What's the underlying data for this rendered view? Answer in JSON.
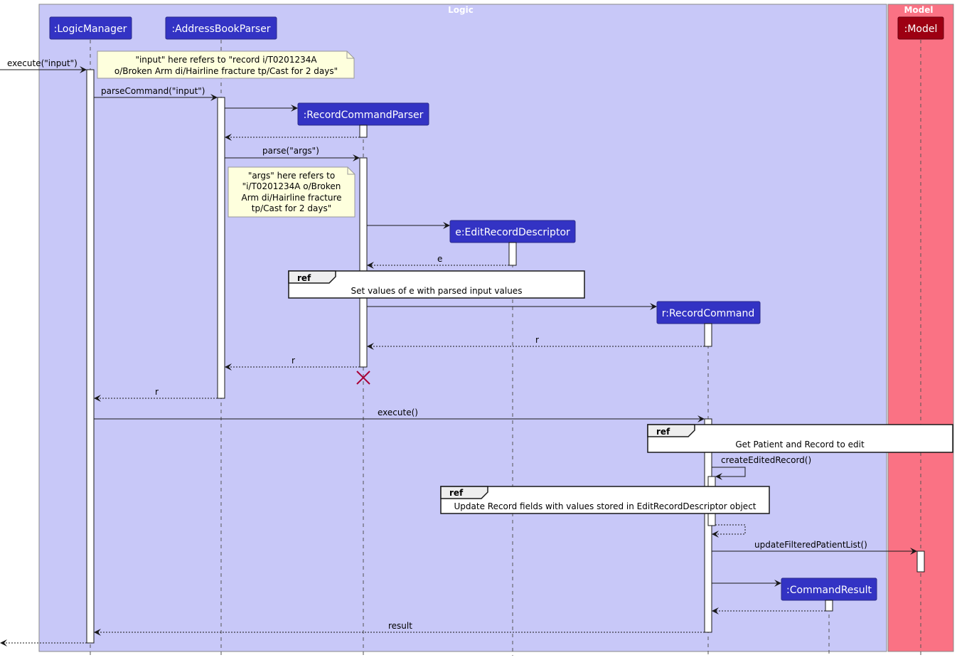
{
  "boxes": {
    "logic": {
      "title": "Logic",
      "color": "#C8C8F8"
    },
    "model": {
      "title": "Model",
      "color": "#FA7284"
    }
  },
  "participants": [
    {
      "id": "lm",
      "label": ":LogicManager",
      "color": "#3333C4"
    },
    {
      "id": "abp",
      "label": ":AddressBookParser",
      "color": "#3333C4"
    },
    {
      "id": "rcp",
      "label": ":RecordCommandParser",
      "color": "#3333C4"
    },
    {
      "id": "erd",
      "label": "e:EditRecordDescriptor",
      "color": "#3333C4"
    },
    {
      "id": "rc",
      "label": "r:RecordCommand",
      "color": "#3333C4"
    },
    {
      "id": "cr",
      "label": ":CommandResult",
      "color": "#3333C4"
    },
    {
      "id": "model",
      "label": ":Model",
      "color": "#9D0012"
    }
  ],
  "notes": {
    "input_note": [
      "\"input\" here refers to \"record i/T0201234A",
      "o/Broken Arm di/Hairline fracture tp/Cast for 2 days\""
    ],
    "args_note": [
      "\"args\" here refers to",
      "\"i/T0201234A o/Broken",
      "Arm di/Hairline fracture",
      "tp/Cast for 2 days\""
    ]
  },
  "messages": {
    "execute_input": "execute(\"input\")",
    "parse_command": "parseCommand(\"input\")",
    "parse_args": "parse(\"args\")",
    "return_e": "e",
    "return_r1": "r",
    "return_r2": "r",
    "return_r3": "r",
    "execute": "execute()",
    "create_edited_record": "createEditedRecord()",
    "update_filtered": "updateFilteredPatientList()",
    "return_result": "result"
  },
  "refs": {
    "tag": "ref",
    "set_values": "Set values of e with parsed input values",
    "get_patient": "Get Patient and Record to edit",
    "update_record": "Update Record fields with values stored in EditRecordDescriptor object"
  },
  "colors": {
    "destroy": "#A80036",
    "note_fill": "#FEFFDD",
    "line": "#181818"
  }
}
